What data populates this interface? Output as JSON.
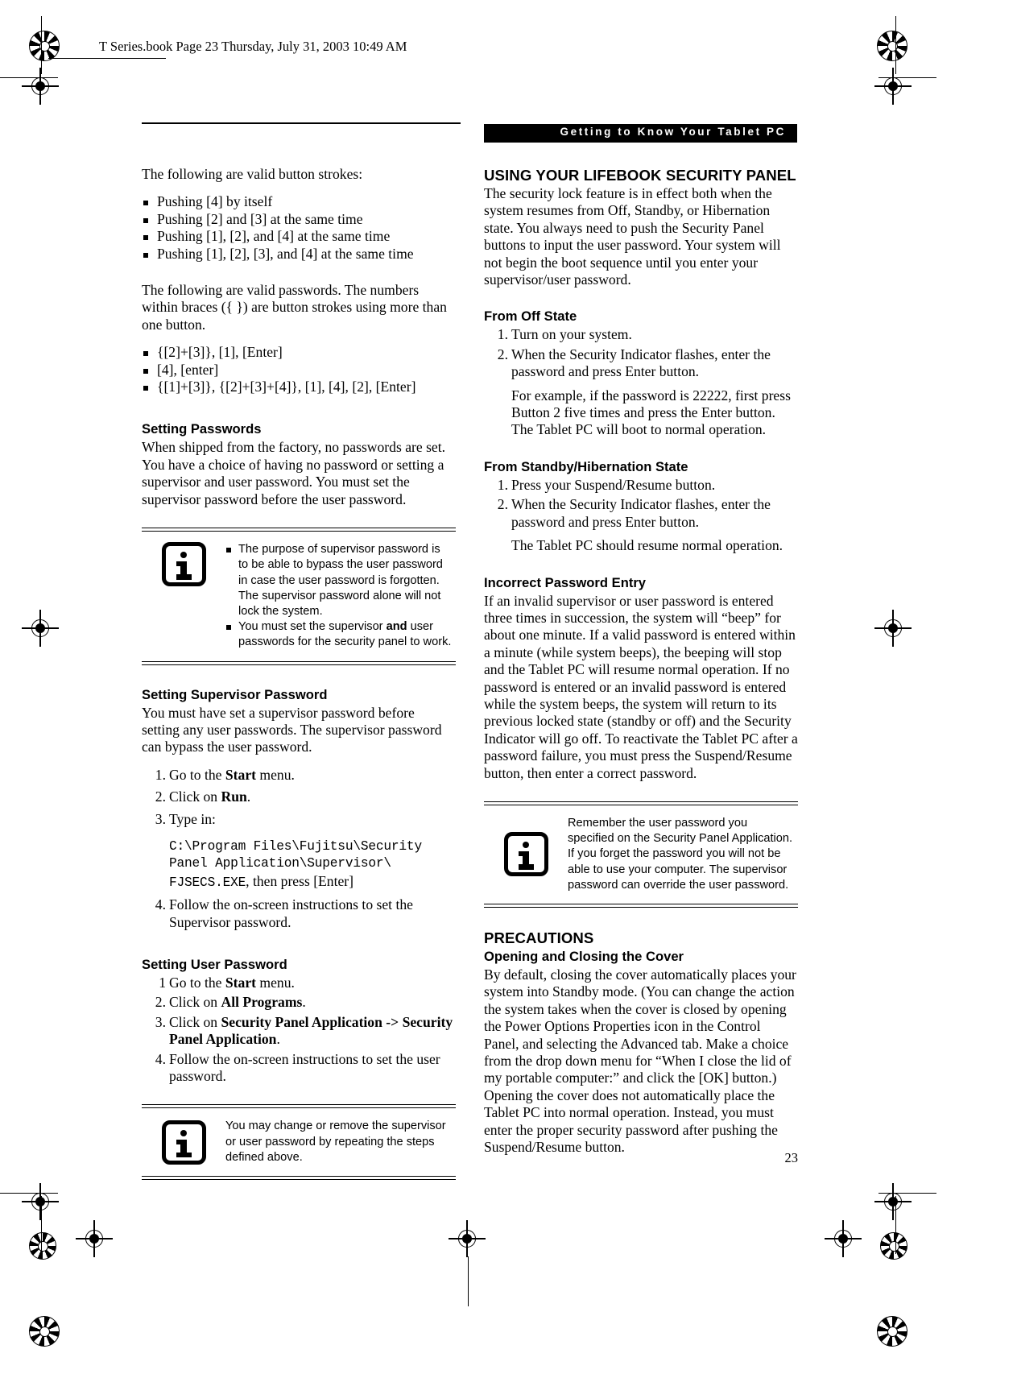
{
  "slug": {
    "text": "T Series.book  Page 23  Thursday, July 31, 2003  10:49 AM"
  },
  "header": {
    "title": "Getting to Know Your Tablet PC"
  },
  "page_number": "23",
  "left_column": {
    "intro_strokes": "The following are valid button strokes:",
    "stroke_items": [
      "Pushing [4] by itself",
      "Pushing [2] and [3] at the same time",
      "Pushing [1], [2], and [4] at the same time",
      "Pushing [1], [2], [3], and [4] at the same time"
    ],
    "intro_passwords": "The following are valid passwords. The numbers within braces ({  }) are button strokes using more than one button.",
    "password_items": [
      "{[2]+[3]}, [1], [Enter]",
      "[4], [enter]",
      "{[1]+[3]}, {[2]+[3]+[4]}, [1], [4], [2], [Enter]"
    ],
    "setting_passwords": {
      "heading": "Setting Passwords",
      "body": "When shipped from the factory, no passwords are set. You have a choice of having no password or setting a supervisor and user password. You must set the supervisor password before the user password."
    },
    "note_1": {
      "bullet_1_pre": "The purpose of supervisor password is to be able to bypass the user password in case the user password is forgotten. The supervisor password alone will not lock the system.",
      "bullet_2_a": "You must set the supervisor ",
      "bullet_2_b": "and",
      "bullet_2_c": " user passwords for the security panel to work."
    },
    "setting_supervisor": {
      "heading": "Setting Supervisor Password",
      "body": "You must have set a supervisor password before setting any user passwords. The supervisor password can bypass the user password.",
      "steps": [
        {
          "n": "1.",
          "pre": "Go to the ",
          "bold": "Start",
          "post": " menu."
        },
        {
          "n": "2.",
          "pre": "Click on ",
          "bold": "Run",
          "post": "."
        },
        {
          "n": "3.",
          "pre": "Type in:",
          "bold": "",
          "post": ""
        },
        {
          "n": "4.",
          "pre": "Follow the on-screen instructions to set the Supervisor password.",
          "bold": "",
          "post": ""
        }
      ],
      "code_line_1": "C:\\Program Files\\Fujitsu\\Security",
      "code_line_2": "Panel Application\\Supervisor\\",
      "code_line_3_mono": "FJSECS.EXE",
      "code_line_3_rest": ", then press [Enter]"
    },
    "setting_user": {
      "heading": "Setting User Password",
      "steps": [
        {
          "n": "1",
          "pre": "Go to the ",
          "bold": "Start",
          "post": " menu."
        },
        {
          "n": "2.",
          "pre": "Click on ",
          "bold": "All Programs",
          "post": "."
        },
        {
          "n": "3.",
          "pre": "Click on ",
          "bold": "Security Panel Application -> Security Panel Application",
          "post": "."
        },
        {
          "n": "4.",
          "pre": "Follow the on-screen instructions to set the user password.",
          "bold": "",
          "post": ""
        }
      ]
    },
    "note_2": {
      "text": "You may change or remove the supervisor or user password by repeating the steps defined above."
    }
  },
  "right_column": {
    "using_panel": {
      "heading": "USING YOUR LIFEBOOK SECURITY PANEL",
      "body": "The security lock feature is in effect both when the system resumes from Off, Standby, or Hibernation state. You always need to push the Security Panel buttons to input the user password. Your system will not begin the boot sequence until you enter your supervisor/user password."
    },
    "from_off": {
      "heading": "From Off State",
      "steps": [
        {
          "n": "1.",
          "text": "Turn on your system."
        },
        {
          "n": "2.",
          "text": "When the Security Indicator flashes, enter the password and press Enter button."
        }
      ],
      "continuation": "For example, if the password is 22222, first press Button 2 five times and press the Enter button. The Tablet PC will boot to normal operation."
    },
    "from_standby": {
      "heading": "From Standby/Hibernation State",
      "steps": [
        {
          "n": "1.",
          "text": "Press your Suspend/Resume button."
        },
        {
          "n": "2.",
          "text": "When the Security Indicator flashes, enter the password and press Enter button."
        }
      ],
      "continuation": "The Tablet PC should resume normal operation."
    },
    "incorrect_entry": {
      "heading": "Incorrect Password Entry",
      "body": "If an invalid supervisor or user password is entered three times in succession, the system will “beep” for about one minute. If a valid password is entered within a minute (while system beeps), the beeping will stop and the Tablet PC will resume normal operation. If no password is entered or an invalid password is entered while the system beeps, the system will return to its previous locked state (standby or off) and the Security Indicator will go off. To reactivate the Tablet PC after a password failure, you must press the Suspend/Resume button, then enter a correct password."
    },
    "note_3": {
      "text": "Remember the user password you specified on the Security Panel Application. If you forget the password you will not be able to use your computer. The supervisor password can override the user password."
    },
    "precautions": {
      "heading": "PRECAUTIONS",
      "subheading": "Opening and Closing the Cover",
      "body": "By default, closing the cover automatically places your system into Standby mode. (You can change the action the system takes when the cover is closed by opening the Power Options Properties icon in the Control Panel, and selecting the Advanced tab. Make a choice from the drop down menu for “When I close the lid of my portable computer:” and click the [OK] button.) Opening the cover does not automatically place the Tablet PC into normal operation. Instead, you must enter the proper security password after pushing the Suspend/Resume button."
    }
  }
}
